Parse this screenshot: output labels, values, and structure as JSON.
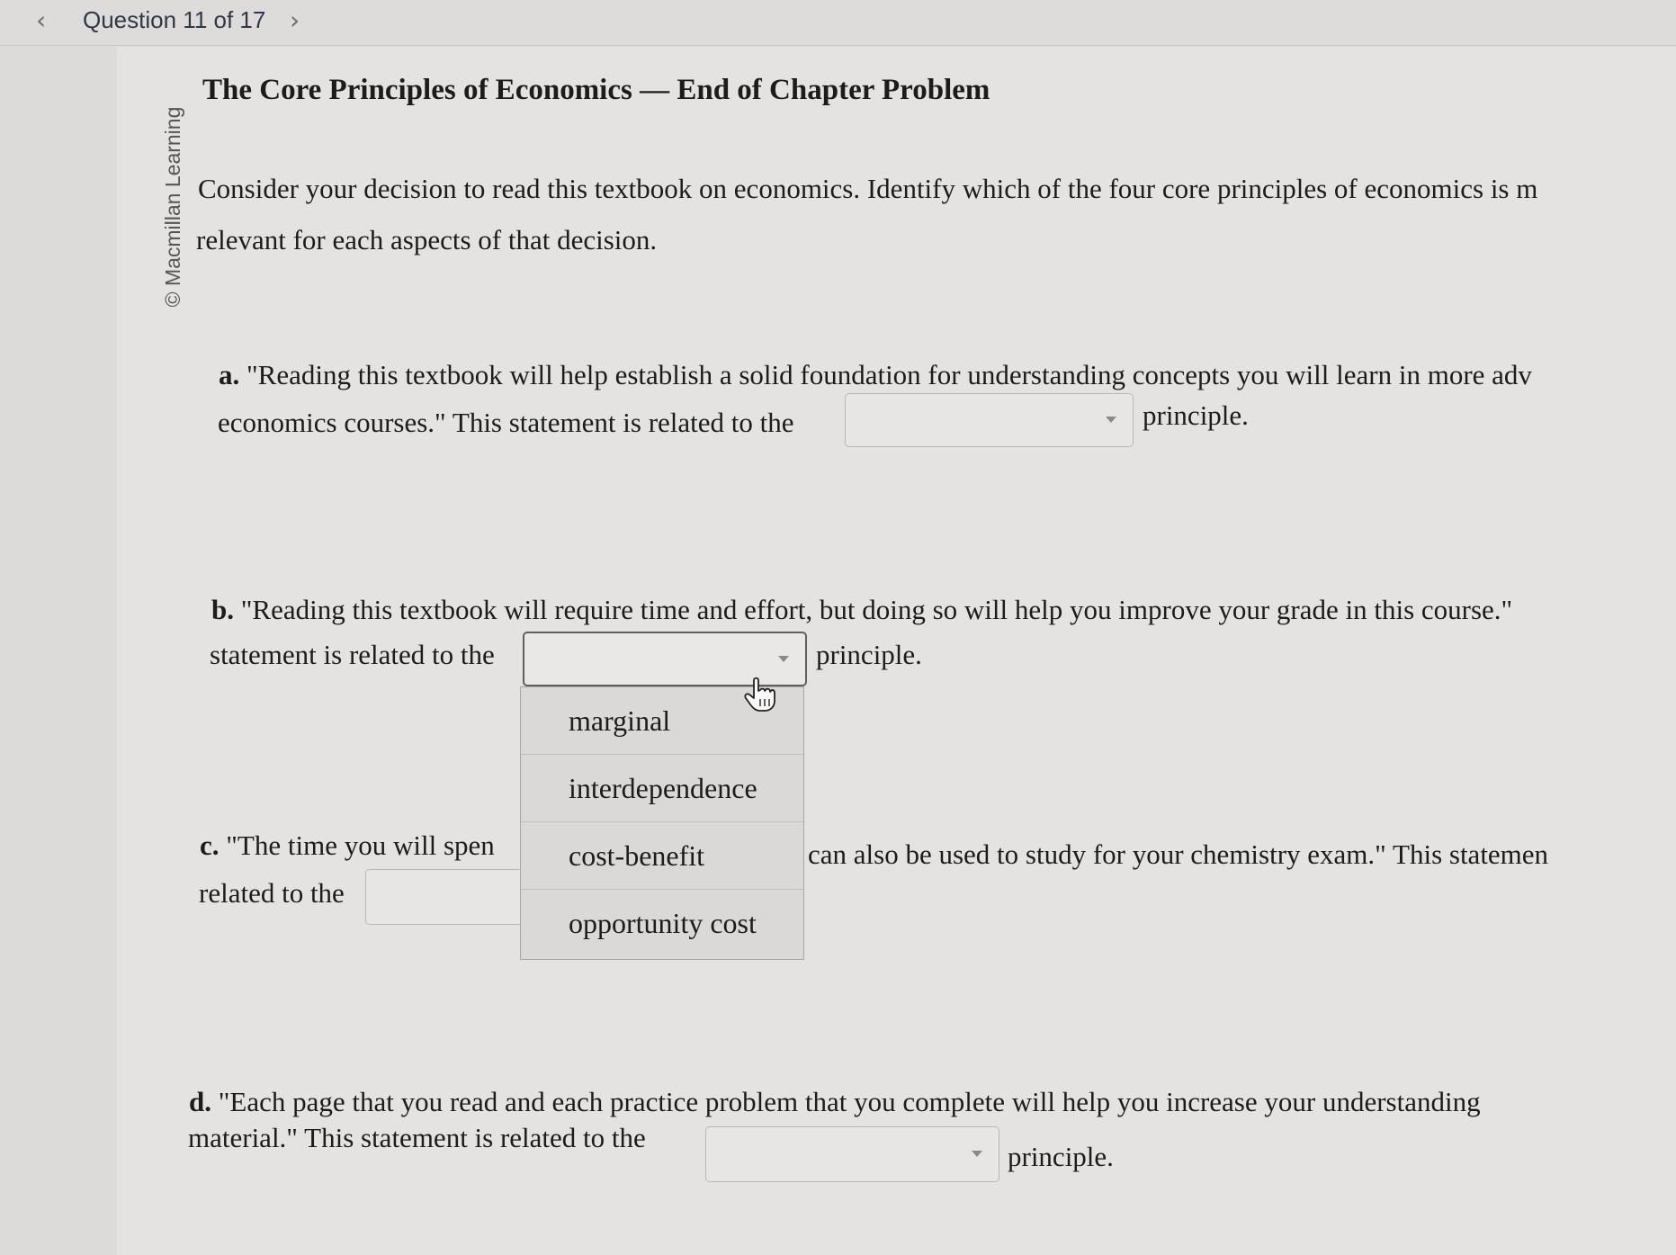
{
  "nav": {
    "prev_icon": "chevron-left-icon",
    "question_counter": "Question 11 of 17",
    "next_icon": "chevron-right-icon"
  },
  "sidebar": {
    "copyright": "© Macmillan Learning"
  },
  "problem": {
    "title": "The Core Principles of Economics — End of Chapter Problem",
    "intro_line1": "Consider your decision to read this textbook on economics. Identify which of the four core principles of economics is m",
    "intro_line2": "relevant for each aspects of that decision."
  },
  "items": {
    "a": {
      "letter": "a.",
      "line1": " \"Reading this textbook will help establish a solid foundation for understanding concepts you will learn in more adv",
      "line2_before": "economics courses.\" This statement is related to the",
      "selected": "",
      "after": "principle."
    },
    "b": {
      "letter": "b.",
      "line1": " \"Reading this textbook will require time and effort, but doing so will help you improve your grade in this course.\"",
      "line2_before": "statement is related to the",
      "selected": "",
      "after": "principle."
    },
    "c": {
      "letter": "c.",
      "line1_before": " \"The time you will spen",
      "line1_after": "can also be used to study for your chemistry exam.\" This statemen",
      "line2_before": "related to the",
      "selected": ""
    },
    "d": {
      "letter": "d.",
      "line1": " \"Each page that you read and each practice problem that you complete will help you increase your understanding",
      "line2_before": "material.\" This statement is related to the",
      "selected": "",
      "after": "principle."
    }
  },
  "dropdown_options": [
    "marginal",
    "interdependence",
    "cost-benefit",
    "opportunity cost"
  ],
  "colors": {
    "background": "#e4e3e1",
    "topbar": "#dddcda",
    "text": "#1c1c1c"
  }
}
